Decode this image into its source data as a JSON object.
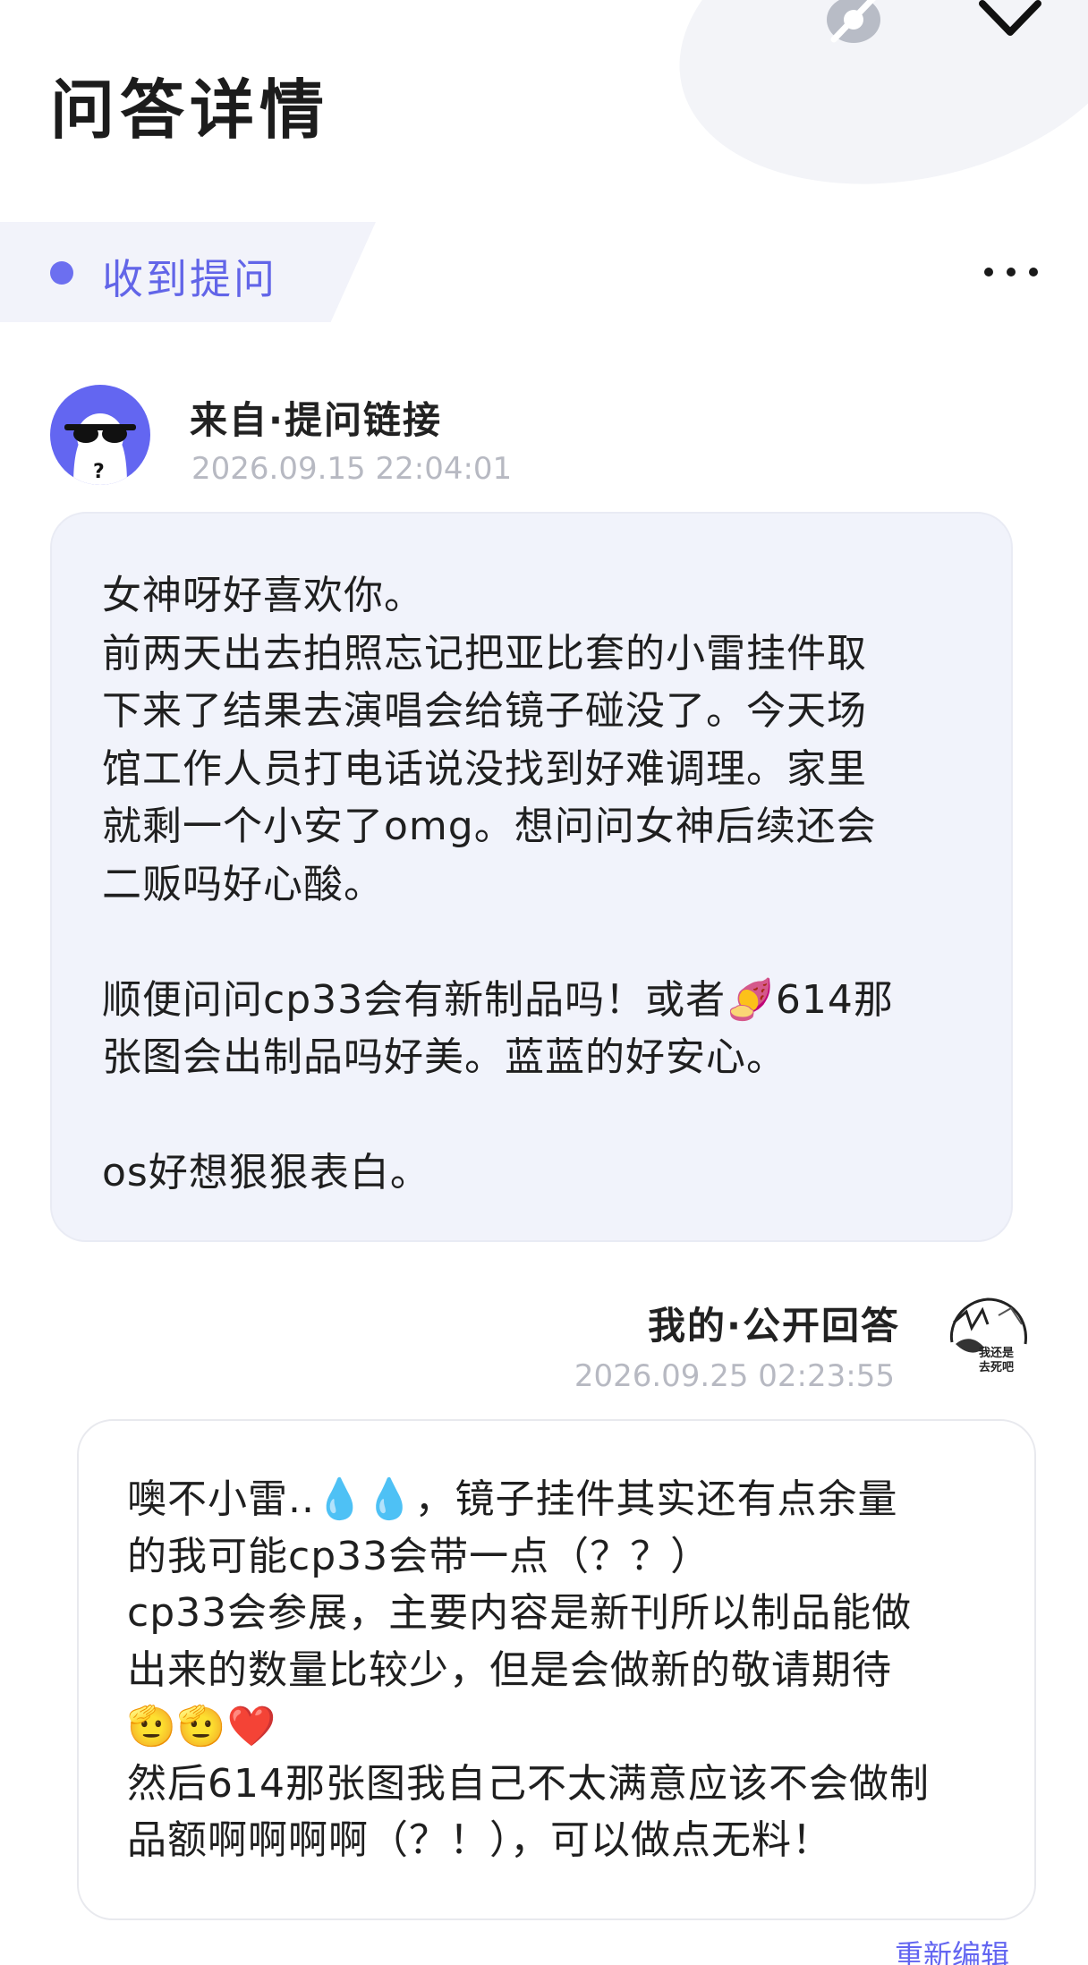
{
  "header": {
    "title": "问答详情"
  },
  "section": {
    "title": "收到提问"
  },
  "question": {
    "from_label": "来自·提问链接",
    "timestamp": "2026.09.15 22:04:01",
    "text": "女神呀好喜欢你。\n前两天出去拍照忘记把亚比套的小雷挂件取\n下来了结果去演唱会给镜子碰没了。今天场\n馆工作人员打电话说没找到好难调理。家里\n就剩一个小安了omg。想问问女神后续还会\n二贩吗好心酸。\n\n顺便问问cp33会有新制品吗！或者🍠614那\n张图会出制品吗好美。蓝蓝的好安心。\n\nos好想狠狠表白。"
  },
  "answer": {
    "label": "我的·公开回答",
    "timestamp": "2026.09.25 02:23:55",
    "text": "噢不小雷..💧💧，镜子挂件其实还有点余量\n的我可能cp33会带一点（？？）\ncp33会参展，主要内容是新刊所以制品能做\n出来的数量比较少，但是会做新的敬请期待\n🫡🫡❤️\n然后614那张图我自己不太满意应该不会做制\n品额啊啊啊啊（？！），可以做点无料！",
    "avatar_text": "我还是去死吧"
  },
  "actions": {
    "reedit_label": "重新编辑"
  },
  "icons": {
    "top_left_icon": "eye-off-icon",
    "top_right_icon": "chevron-down-icon",
    "more_icon": "more-dots-icon"
  },
  "colors": {
    "accent": "#6366f1",
    "question_bubble_bg": "#f1f3fb",
    "timestamp": "#b7b9c2"
  }
}
